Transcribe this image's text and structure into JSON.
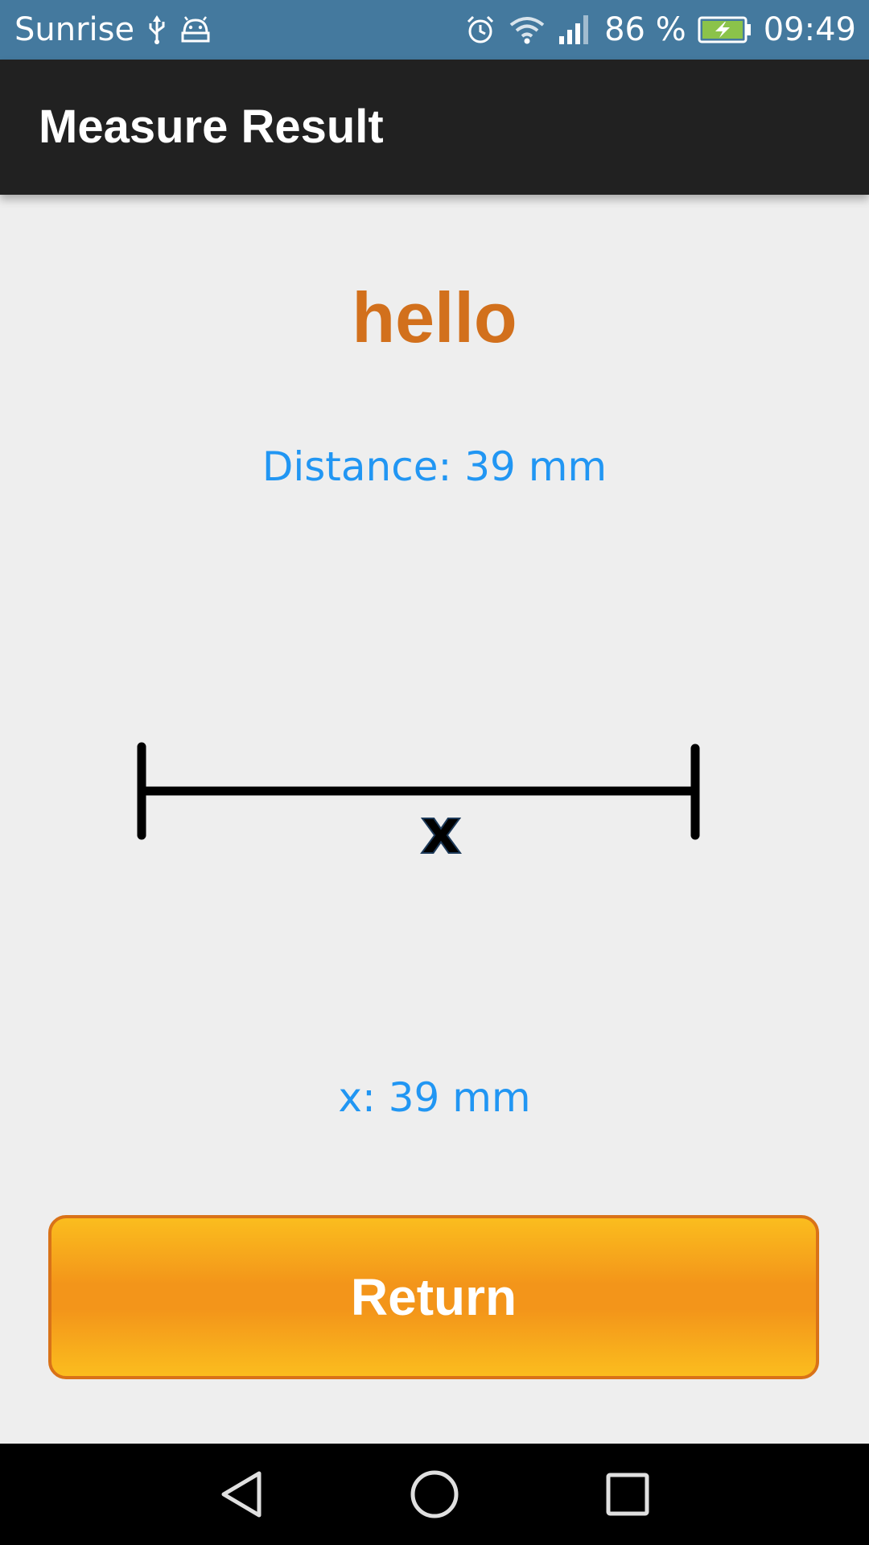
{
  "status_bar": {
    "carrier": "Sunrise",
    "battery": "86 %",
    "time": "09:49",
    "icons": [
      "usb-icon",
      "android-debug-icon",
      "alarm-icon",
      "wifi-icon",
      "signal-icon",
      "battery-charging-icon"
    ]
  },
  "app_bar": {
    "title": "Measure Result"
  },
  "content": {
    "heading": "hello",
    "distance": "Distance: 39 mm",
    "diagram_label": "x",
    "x_value": "x: 39 mm"
  },
  "actions": {
    "return_label": "Return"
  },
  "nav_bar": {
    "icons": [
      "back-icon",
      "home-icon",
      "recents-icon"
    ]
  },
  "colors": {
    "status_bar": "#44799e",
    "app_bar": "#212121",
    "background": "#eeeeee",
    "heading": "#d2701c",
    "info_text": "#2196f3",
    "button_fill": "#f3951a",
    "button_border": "#d97218",
    "battery_fill": "#8bc34a"
  }
}
